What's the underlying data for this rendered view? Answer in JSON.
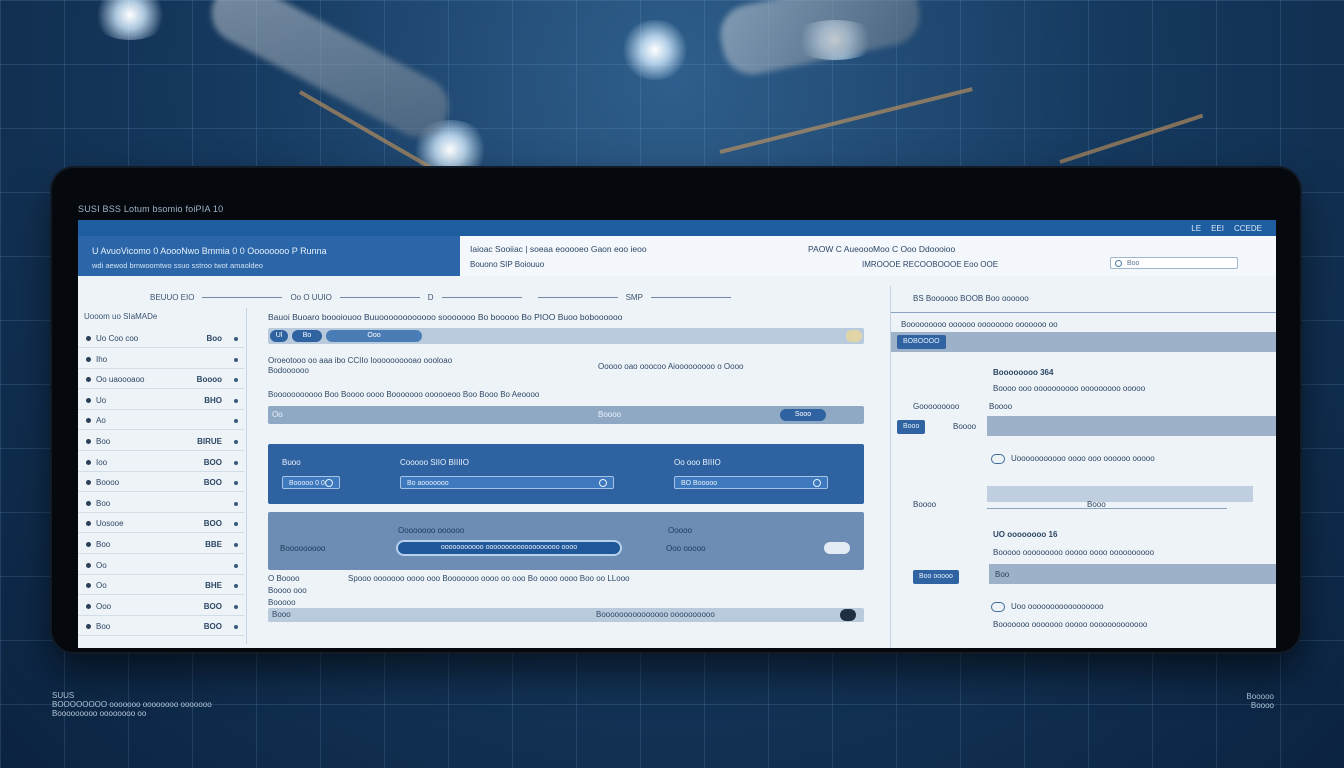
{
  "bezel": {
    "title": "SUSI BSS  Lotum bsomio foiPIA  10"
  },
  "topbar": {
    "items": [
      "LE",
      "EEI",
      "CCEDE"
    ]
  },
  "header": {
    "brand_title": "U AvuoVicomo 0   AoooNwo Bmmia 0 0   Oooooooo P Runna",
    "brand_sub": "wdi aewod bmwoomtwo ssuo sstroo twot amaoldeo",
    "mid_title": "Iaioac Sooiiac  |  soeaa eooooeo  Gaon eoo  ieoo",
    "mid_sub": "Bouono SIP  Boiouuo",
    "right_title": "PAOW  C     AueoooMoo  C Ooo Ddoooioo",
    "right_sub": "IMROOOE RECOOBOOOE  Eoo OOE",
    "search_placeholder": "Boo"
  },
  "toolbar": {
    "items": [
      "BEUUO  EIO",
      "Oo  O UUIO",
      "D",
      "SMP"
    ]
  },
  "sidebar": {
    "head": "Uooom uo   SIaMADe",
    "items": [
      {
        "label": "Uo  Coo coo",
        "value": "Boo"
      },
      {
        "label": "Iho",
        "value": ""
      },
      {
        "label": "Oo uaoooaoo",
        "value": "Boooo"
      },
      {
        "label": "Uo",
        "value": "BHO"
      },
      {
        "label": "Ao",
        "value": ""
      },
      {
        "label": "Boo",
        "value": "BIRUE"
      },
      {
        "label": "Ioo",
        "value": "BOO"
      },
      {
        "label": "Boooo",
        "value": "BOO"
      },
      {
        "label": "Boo",
        "value": ""
      },
      {
        "label": "Uosooe",
        "value": "BOO"
      },
      {
        "label": "Boo",
        "value": "BBE"
      },
      {
        "label": "Oo",
        "value": ""
      },
      {
        "label": "Oo",
        "value": "BHE"
      },
      {
        "label": "Ooo",
        "value": "BOO"
      },
      {
        "label": "Boo",
        "value": "BOO"
      }
    ]
  },
  "main": {
    "head": "Bauoi  Buoaro boooiouoo Buuoooooooooooo   sooooooo Bo booooo Bo PIOO   Buoo  boboooooo",
    "tabs": [
      "Ul",
      "Bo",
      "Ooo"
    ],
    "section1_title": "Oroeotooo oo  aaa ibo  CCIIo Ioooooooooao oooloao",
    "section1_right": "Ooooo  oao ooocoo  Aiooooooooo o Oooo",
    "section1_sub": "Bodoooooo",
    "filter_row": "Booooooooooo  Boo  Boooo oooo Booooooo oooooeoo   Boo Booo   Bo   Aeoooo",
    "row2_left": "Oo",
    "row2_mid": "Boooo",
    "row2_button": "Sooo",
    "card1": {
      "label_left": "Buoo",
      "label_mid": "Cooooo  SIIO   BIIIIO",
      "label_right": "Oo  ooo  BIIIO",
      "field_left": "Booooo   0   0",
      "field_mid": "Bo  aooooooo",
      "field_right": "BO  Booooo"
    },
    "card2": {
      "label_top": "Oooooooo oooooo",
      "label_right": "Ooooo",
      "label_left": "Booooooooo",
      "pill_text": "ooooooooooo ooooooooooooooooooo oooo",
      "label_far": "Ooo ooooo"
    },
    "bottom_title": "O Boooo",
    "bottom_sub1": "Boooo ooo",
    "bottom_sub2": "Booooo",
    "bottom_row": "Spooo ooooooo oooo ooo   Booooooo oooo oo ooo   Bo oooo oooo Boo oo  LLooo",
    "status_left": "Booo",
    "status_mid": "Booooooooooooooo oooooooooo"
  },
  "rpanel": {
    "head": "BS  Boooooo BOOB   Boo oooooo",
    "sub": "Booooooooo oooooo oooooooo ooooooo oo",
    "chip1": "BOBOOOO",
    "block1_title": "Boooooooo 364",
    "block1_sub": "Boooo ooo oooooooooo ooooooooo ooooo",
    "block1_left": "Gooooooooo",
    "block1_right": "Boooo",
    "chip2": "Booo",
    "chip2_side": "Boooo",
    "block2_title": "Uooooooooooo oooo ooo oooooo ooooo",
    "block2_left": "Boooo",
    "block2_step": "Booo",
    "block3_title": "UO oooooooo 16",
    "block3_sub": "Booooo ooooooooo ooooo oooo oooooooooo",
    "chip3": "Boo ooooo",
    "block3_row": "Boo",
    "block4_title": "Uoo ooooooooooooooooo",
    "block4_sub": "Booooooo ooooooo ooooo ooooooooooooo"
  },
  "floor": {
    "left_line1": "SUUS",
    "left_line2": "BOOOOOOOO ooooooo oooooooo ooooooo",
    "left_line3": "Booooooooo oooooooo oo",
    "right_line1": "Booooo",
    "right_line2": "Boooo"
  }
}
